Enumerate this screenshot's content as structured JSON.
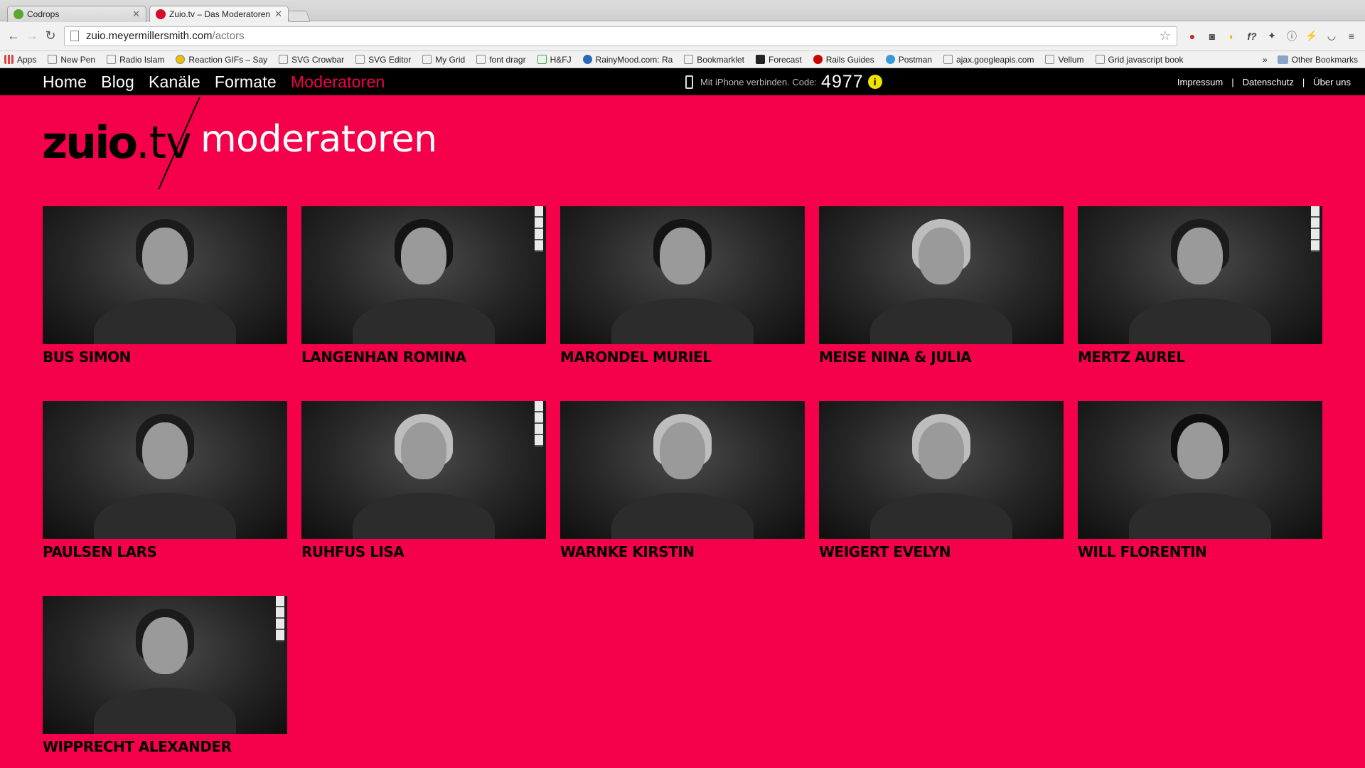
{
  "browser": {
    "tabs": [
      {
        "title": "Codrops",
        "favicon_color": "#5aa832",
        "active": false
      },
      {
        "title": "Zuio.tv – Das Moderatoren",
        "favicon_color": "#d40c2d",
        "active": true
      }
    ],
    "url_host": "zuio.meyermillersmith.com",
    "url_path": "/actors",
    "bookmarks": [
      "Apps",
      "New Pen",
      "Radio Islam",
      "Reaction GIFs – Say",
      "SVG Crowbar",
      "SVG Editor",
      "My Grid",
      "font dragr",
      "H&FJ",
      "RainyMood.com: Ra",
      "Bookmarklet",
      "Forecast",
      "Rails Guides",
      "Postman",
      "ajax.googleapis.com",
      "Vellum",
      "Grid javascript book"
    ],
    "bookmarks_overflow": "»",
    "other_bookmarks": "Other Bookmarks"
  },
  "site": {
    "nav": [
      "Home",
      "Blog",
      "Kanäle",
      "Formate",
      "Moderatoren"
    ],
    "active_nav": "Moderatoren",
    "connect_label": "Mit iPhone verbinden. Code:",
    "connect_code": "4977",
    "meta_links": [
      "Impressum",
      "Datenschutz",
      "Über uns"
    ],
    "logo_main": "zuio",
    "logo_tld": ".tv",
    "page_title": "moderatoren",
    "accent_color": "#f5004a"
  },
  "moderators": [
    {
      "name": "BUS SIMON",
      "hair": "short",
      "window": false
    },
    {
      "name": "LANGENHAN ROMINA",
      "hair": "long",
      "window": true
    },
    {
      "name": "MARONDEL MURIEL",
      "hair": "long",
      "window": false
    },
    {
      "name": "MEISE NINA & JULIA",
      "hair": "blonde",
      "window": false
    },
    {
      "name": "MERTZ AUREL",
      "hair": "short",
      "window": true
    },
    {
      "name": "PAULSEN LARS",
      "hair": "short",
      "window": false
    },
    {
      "name": "RUHFUS LISA",
      "hair": "blonde",
      "window": true
    },
    {
      "name": "WARNKE KIRSTIN",
      "hair": "blonde",
      "window": false
    },
    {
      "name": "WEIGERT EVELYN",
      "hair": "blonde",
      "window": false
    },
    {
      "name": "WILL FLORENTIN",
      "hair": "curly",
      "window": false
    },
    {
      "name": "WIPPRECHT ALEXANDER",
      "hair": "short",
      "window": true
    }
  ]
}
